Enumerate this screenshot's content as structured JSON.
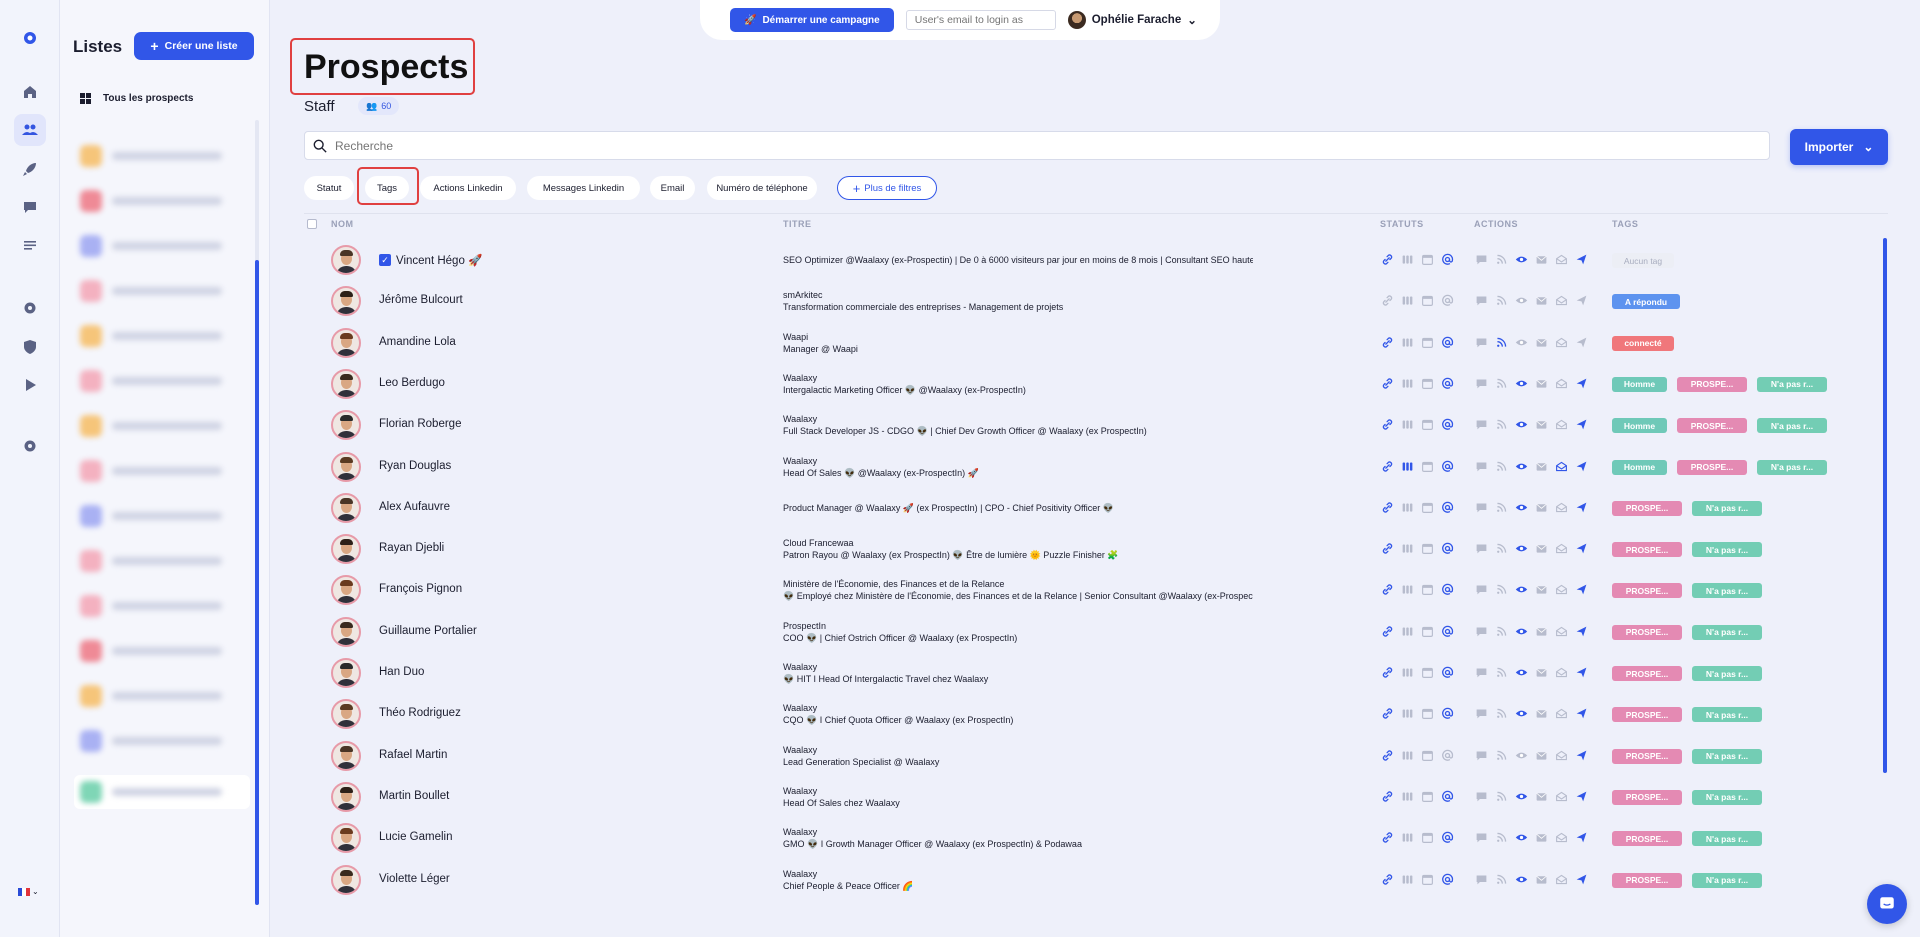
{
  "topbar": {
    "campaign_label": "Démarrer une campagne",
    "email_placeholder": "User's email to login as",
    "user_name": "Ophélie Farache"
  },
  "lists_panel": {
    "title": "Listes",
    "create_label": "Créer une liste",
    "all_prospects_label": "Tous les prospects",
    "entry_colors": [
      "#f6c57a",
      "#ef8a96",
      "#a9b1f3",
      "#f4b1c0",
      "#f6c57a",
      "#f4b1c0",
      "#f6c57a",
      "#f4b1c0",
      "#a9b1f3",
      "#f4b1c0",
      "#f4b1c0",
      "#ef8a96",
      "#f6c57a",
      "#a9b1f3",
      "#7fd6b6"
    ]
  },
  "rail_icons": [
    "logo-icon",
    "home-icon",
    "users-icon",
    "rocket-icon",
    "message-icon",
    "list-icon",
    "settings-icon",
    "shield-icon",
    "play-icon",
    "gear-icon"
  ],
  "page": {
    "title": "Prospects",
    "subtitle": "Staff",
    "count": "60",
    "search_placeholder": "Recherche",
    "import_label": "Importer"
  },
  "filters": [
    "Statut",
    "Tags",
    "Actions Linkedin",
    "Messages Linkedin",
    "Email",
    "Numéro de téléphone"
  ],
  "more_filters_label": "Plus de filtres",
  "table": {
    "headers": {
      "nom": "NOM",
      "titre": "TITRE",
      "statuts": "STATUTS",
      "actions": "ACTIONS",
      "tags": "TAGS"
    },
    "rows": [
      {
        "name": "Vincent Hégo 🚀",
        "checked": true,
        "title1": "SEO Optimizer @Waalaxy (ex-Prospectin) | De 0 à 6000 visiteurs par jour en moins de 8 mois | Consultant SEO haute perfo...",
        "title2": "",
        "tags": [
          {
            "label": "Aucun tag",
            "cls": "none"
          }
        ]
      },
      {
        "name": "Jérôme Bulcourt",
        "title1": "smArkitec",
        "title2": "Transformation commerciale des entreprises - Management de projets",
        "tags": [
          {
            "label": "A répondu",
            "cls": "blue"
          }
        ]
      },
      {
        "name": "Amandine Lola",
        "title1": "Waapi",
        "title2": "Manager @ Waapi",
        "tags": [
          {
            "label": "connecté",
            "cls": "red"
          }
        ]
      },
      {
        "name": "Leo Berdugo",
        "title1": "Waalaxy",
        "title2": "Intergalactic Marketing Officer 👽 @Waalaxy (ex-ProspectIn)",
        "tags": [
          {
            "label": "Homme",
            "cls": "teal"
          },
          {
            "label": "PROSPE...",
            "cls": "pink"
          },
          {
            "label": "N'a pas r...",
            "cls": "green"
          }
        ]
      },
      {
        "name": "Florian Roberge",
        "title1": "Waalaxy",
        "title2": "Full Stack Developer JS - CDGO 👽 | Chief Dev Growth Officer @ Waalaxy (ex ProspectIn)",
        "tags": [
          {
            "label": "Homme",
            "cls": "teal"
          },
          {
            "label": "PROSPE...",
            "cls": "pink"
          },
          {
            "label": "N'a pas r...",
            "cls": "green"
          }
        ]
      },
      {
        "name": "Ryan Douglas",
        "title1": "Waalaxy",
        "title2": "Head Of Sales 👽 @Waalaxy (ex-ProspectIn) 🚀",
        "tags": [
          {
            "label": "Homme",
            "cls": "teal"
          },
          {
            "label": "PROSPE...",
            "cls": "pink"
          },
          {
            "label": "N'a pas r...",
            "cls": "green"
          }
        ]
      },
      {
        "name": "Alex Aufauvre",
        "title1": "Product Manager @ Waalaxy 🚀 (ex ProspectIn) | CPO - Chief Positivity Officer 👽",
        "title2": "",
        "tags": [
          {
            "label": "PROSPE...",
            "cls": "pink"
          },
          {
            "label": "N'a pas r...",
            "cls": "green"
          }
        ]
      },
      {
        "name": "Rayan Djebli",
        "title1": "Cloud Francewaa",
        "title2": "Patron Rayou @ Waalaxy (ex ProspectIn) 👽 Être de lumière 🌞 Puzzle Finisher 🧩",
        "tags": [
          {
            "label": "PROSPE...",
            "cls": "pink"
          },
          {
            "label": "N'a pas r...",
            "cls": "green"
          }
        ]
      },
      {
        "name": "François Pignon",
        "title1": "Ministère de l'Économie, des Finances et de la Relance",
        "title2": "👽 Employé chez Ministère de l'Économie, des Finances et de la Relance  |  Senior Consultant @Waalaxy (ex-ProspectIn) 👽",
        "tags": [
          {
            "label": "PROSPE...",
            "cls": "pink"
          },
          {
            "label": "N'a pas r...",
            "cls": "green"
          }
        ]
      },
      {
        "name": "Guillaume Portalier",
        "title1": "ProspectIn",
        "title2": "COO 👽 | Chief Ostrich Officer @ Waalaxy (ex ProspectIn)",
        "tags": [
          {
            "label": "PROSPE...",
            "cls": "pink"
          },
          {
            "label": "N'a pas r...",
            "cls": "green"
          }
        ]
      },
      {
        "name": "Han Duo",
        "title1": "Waalaxy",
        "title2": "👽 HIT I Head Of Intergalactic Travel chez Waalaxy",
        "tags": [
          {
            "label": "PROSPE...",
            "cls": "pink"
          },
          {
            "label": "N'a pas r...",
            "cls": "green"
          }
        ]
      },
      {
        "name": "Théo Rodriguez",
        "title1": "Waalaxy",
        "title2": "CQO 👽 I Chief Quota Officer @ Waalaxy (ex ProspectIn)",
        "tags": [
          {
            "label": "PROSPE...",
            "cls": "pink"
          },
          {
            "label": "N'a pas r...",
            "cls": "green"
          }
        ]
      },
      {
        "name": "Rafael Martin",
        "title1": "Waalaxy",
        "title2": "Lead Generation Specialist @ Waalaxy",
        "tags": [
          {
            "label": "PROSPE...",
            "cls": "pink"
          },
          {
            "label": "N'a pas r...",
            "cls": "green"
          }
        ]
      },
      {
        "name": "Martin Boullet",
        "title1": "Waalaxy",
        "title2": "Head Of Sales chez Waalaxy",
        "tags": [
          {
            "label": "PROSPE...",
            "cls": "pink"
          },
          {
            "label": "N'a pas r...",
            "cls": "green"
          }
        ]
      },
      {
        "name": "Lucie Gamelin",
        "title1": "Waalaxy",
        "title2": "GMO 👽 I Growth Manager Officer @ Waalaxy (ex ProspectIn) & Podawaa",
        "tags": [
          {
            "label": "PROSPE...",
            "cls": "pink"
          },
          {
            "label": "N'a pas r...",
            "cls": "green"
          }
        ]
      },
      {
        "name": "Violette Léger",
        "title1": "Waalaxy",
        "title2": "Chief People & Peace Officer 🌈",
        "tags": [
          {
            "label": "PROSPE...",
            "cls": "pink"
          },
          {
            "label": "N'a pas r...",
            "cls": "green"
          }
        ]
      }
    ]
  },
  "colors": {
    "accent": "#3156e8",
    "highlight_box": "#e04040"
  }
}
